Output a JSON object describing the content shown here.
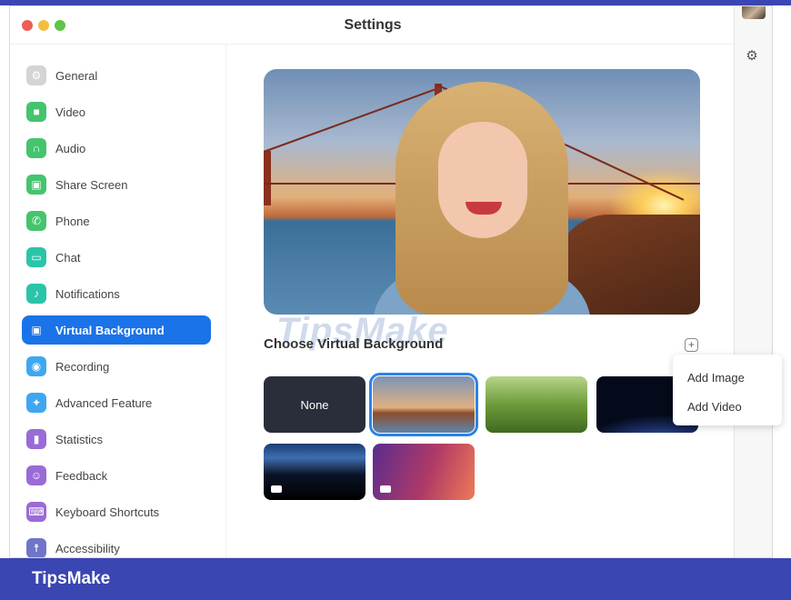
{
  "window": {
    "title": "Settings"
  },
  "sidebar": {
    "items": [
      {
        "label": "General",
        "icon": "gear-icon",
        "color": "#c7c7c7"
      },
      {
        "label": "Video",
        "icon": "video-icon",
        "color": "#45c46e"
      },
      {
        "label": "Audio",
        "icon": "headphones-icon",
        "color": "#45c46e"
      },
      {
        "label": "Share Screen",
        "icon": "share-screen-icon",
        "color": "#45c46e"
      },
      {
        "label": "Phone",
        "icon": "phone-icon",
        "color": "#45c46e"
      },
      {
        "label": "Chat",
        "icon": "chat-icon",
        "color": "#2bc4a8"
      },
      {
        "label": "Notifications",
        "icon": "bell-icon",
        "color": "#2bc4a8"
      },
      {
        "label": "Virtual Background",
        "icon": "portrait-icon",
        "color": "#1a73e8"
      },
      {
        "label": "Recording",
        "icon": "record-icon",
        "color": "#3fa7f0"
      },
      {
        "label": "Advanced Feature",
        "icon": "sparkle-icon",
        "color": "#3fa7f0"
      },
      {
        "label": "Statistics",
        "icon": "bar-chart-icon",
        "color": "#9a6bd6"
      },
      {
        "label": "Feedback",
        "icon": "smiley-icon",
        "color": "#9a6bd6"
      },
      {
        "label": "Keyboard Shortcuts",
        "icon": "keyboard-icon",
        "color": "#9a6bd6"
      },
      {
        "label": "Accessibility",
        "icon": "accessibility-icon",
        "color": "#6f76c8"
      }
    ],
    "active": "Virtual Background"
  },
  "main": {
    "watermark": "TipsMake",
    "section_title": "Choose Virtual Background",
    "backgrounds": [
      {
        "label": "None",
        "kind": "none"
      },
      {
        "label": "",
        "kind": "bridge",
        "selected": true
      },
      {
        "label": "",
        "kind": "grass"
      },
      {
        "label": "",
        "kind": "earth"
      },
      {
        "label": "",
        "kind": "space",
        "video": true
      },
      {
        "label": "",
        "kind": "gradient",
        "video": true
      }
    ],
    "add_menu": {
      "items": [
        "Add Image",
        "Add Video"
      ]
    }
  },
  "footer": {
    "brand": "TipsMake"
  },
  "colors": {
    "accent": "#1a73e8",
    "brand_bar": "#3a46b2"
  }
}
